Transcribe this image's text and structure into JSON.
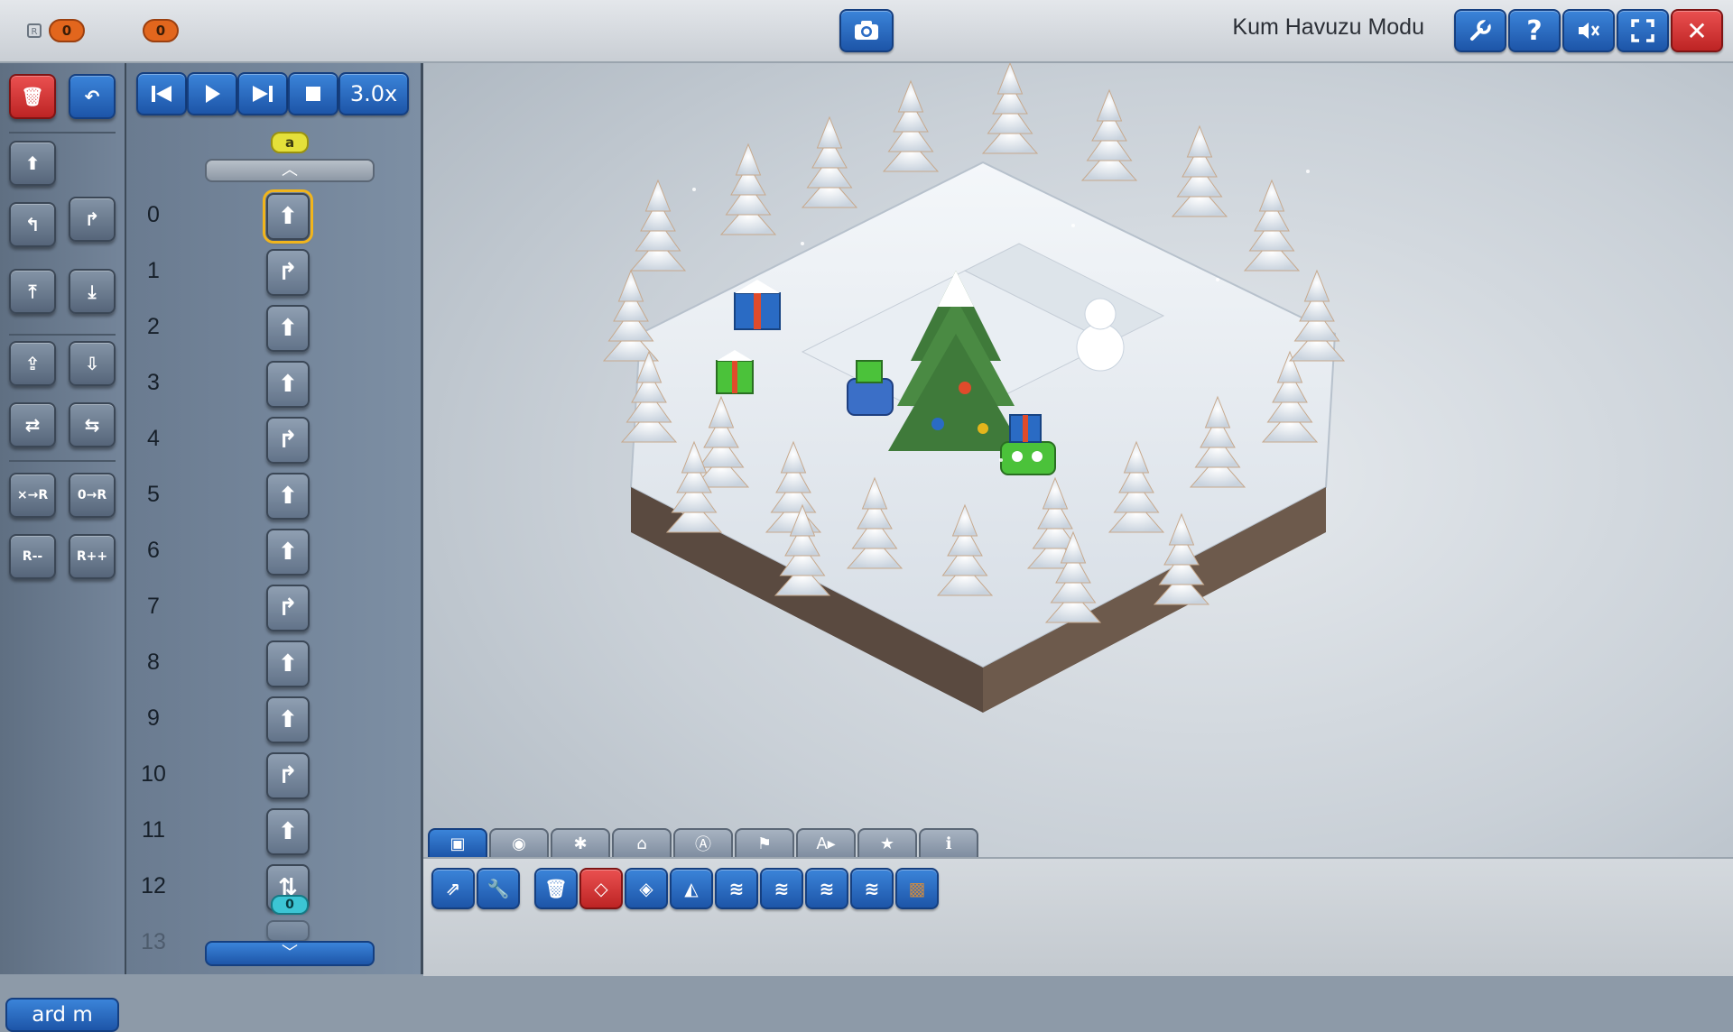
{
  "topbar": {
    "title": "Kum Havuzu Modu",
    "counter_icon": "register-icon",
    "counter1": "0",
    "counter2": "0",
    "buttons": [
      "wrench-icon",
      "help-icon",
      "mute-icon",
      "fullscreen-icon",
      "close-icon"
    ],
    "help_label": "?",
    "close_label": "✕"
  },
  "playback": {
    "speed": "3.0x"
  },
  "program": {
    "label_top": "a",
    "label_bottom": "0",
    "rows": [
      {
        "n": "0",
        "cmd": "forward",
        "glyph": "⬆"
      },
      {
        "n": "1",
        "cmd": "turn-right",
        "glyph": "↱"
      },
      {
        "n": "2",
        "cmd": "forward",
        "glyph": "⬆"
      },
      {
        "n": "3",
        "cmd": "forward",
        "glyph": "⬆"
      },
      {
        "n": "4",
        "cmd": "turn-right",
        "glyph": "↱"
      },
      {
        "n": "5",
        "cmd": "forward",
        "glyph": "⬆"
      },
      {
        "n": "6",
        "cmd": "forward",
        "glyph": "⬆"
      },
      {
        "n": "7",
        "cmd": "turn-right",
        "glyph": "↱"
      },
      {
        "n": "8",
        "cmd": "forward",
        "glyph": "⬆"
      },
      {
        "n": "9",
        "cmd": "forward",
        "glyph": "⬆"
      },
      {
        "n": "10",
        "cmd": "turn-right",
        "glyph": "↱"
      },
      {
        "n": "11",
        "cmd": "forward",
        "glyph": "⬆"
      },
      {
        "n": "12",
        "cmd": "register-op",
        "glyph": "⇅"
      },
      {
        "n": "13",
        "cmd": "",
        "glyph": ""
      }
    ]
  },
  "sidebar": {
    "bottom_label": "ard m",
    "tools": [
      {
        "name": "delete-program-button",
        "glyph": "🗑"
      },
      {
        "name": "undo-button",
        "glyph": "↶"
      },
      {
        "name": "forward-tool",
        "glyph": "⬆"
      },
      {
        "name": "turn-left-tool",
        "glyph": "↰"
      },
      {
        "name": "turn-right-tool",
        "glyph": "↱"
      },
      {
        "name": "pickup-tool",
        "glyph": "⤒"
      },
      {
        "name": "drop-tool",
        "glyph": "⤓"
      },
      {
        "name": "export-tool",
        "glyph": "⇪"
      },
      {
        "name": "import-tool",
        "glyph": "⇩"
      },
      {
        "name": "read-register-tool",
        "glyph": "⇄"
      },
      {
        "name": "write-register-tool",
        "glyph": "⇆"
      },
      {
        "name": "multiply-register-tool",
        "glyph": "×→R"
      },
      {
        "name": "zero-register-tool",
        "glyph": "0→R"
      },
      {
        "name": "decrement-register-tool",
        "glyph": "R--"
      },
      {
        "name": "increment-register-tool",
        "glyph": "R++"
      }
    ]
  },
  "bottom_tabs": [
    "blocks-tab",
    "camera-tab",
    "snowflake-tab",
    "vehicle-tab",
    "sign-tab",
    "flag-tab",
    "label-tab",
    "star-tab",
    "info-tab"
  ],
  "block_tools": [
    "terrain-paint-button",
    "wrench-button",
    "delete-block-button",
    "flat-tile-button",
    "cube-button",
    "slope-button",
    "stack-2-button",
    "stack-3-button",
    "stack-4-button",
    "stack-5-button",
    "crate-button"
  ],
  "colors": {
    "accent_blue": "#2a6bc4",
    "counter_orange": "#e2661d",
    "close_red": "#d03030",
    "selection_gold": "#f1b51c"
  }
}
